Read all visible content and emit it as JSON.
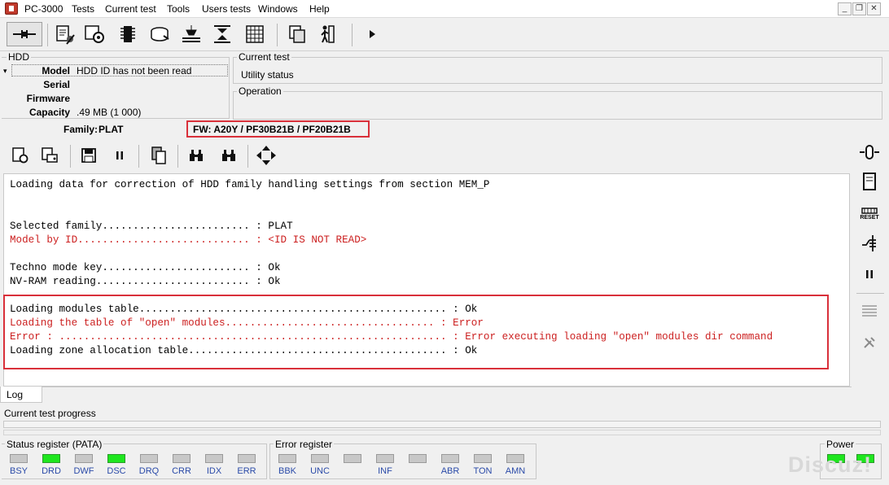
{
  "menubar": {
    "app_title": "PC-3000",
    "items": [
      "Tests",
      "Current test",
      "Tools",
      "Users tests",
      "Windows",
      "Help"
    ],
    "window_buttons": [
      "_",
      "❐",
      "✕"
    ]
  },
  "toolbar": {
    "icons": [
      "connect-icon",
      "test-tools-icon",
      "settings-gear-icon",
      "chip-icon",
      "hdd-icon",
      "head-icon",
      "head-map-icon",
      "grid-icon",
      "copy-windows-icon",
      "run-man-icon",
      "play-icon"
    ]
  },
  "hdd": {
    "title": "HDD",
    "model_label": "Model",
    "model_value": "HDD ID has not been read",
    "serial_label": "Serial",
    "serial_value": "",
    "firmware_label": "Firmware",
    "firmware_value": "",
    "capacity_label": "Capacity",
    "capacity_value": ".49 MB (1 000)",
    "family_label": "Family:",
    "family_value": "PLAT"
  },
  "current_test": {
    "title": "Current test",
    "value": "Utility status"
  },
  "operation": {
    "title": "Operation"
  },
  "fw": {
    "text": "FW: A20Y / PF30B21B / PF20B21B"
  },
  "log": {
    "lines": [
      {
        "text": "Loading data for correction of HDD family handling settings from section MEM_P",
        "color": "#000000"
      },
      {
        "text": "Selected family........................ : PLAT",
        "color": "#000000"
      },
      {
        "text": "Model by ID............................ : <ID IS NOT READ>",
        "color": "#cc2020"
      },
      {
        "text": "Techno mode key........................ : Ok",
        "color": "#000000"
      },
      {
        "text": "NV-RAM reading......................... : Ok",
        "color": "#000000"
      },
      {
        "text": "Loading modules table.................................................. : Ok",
        "color": "#000000"
      },
      {
        "text": "Loading the table of \"open\" modules.................................. : Error",
        "color": "#cc2020"
      },
      {
        "text": "Error : ............................................................... : Error executing loading \"open\" modules dir command",
        "color": "#cc2020"
      },
      {
        "text": "Loading zone allocation table.......................................... : Ok",
        "color": "#000000"
      }
    ],
    "tab_label": "Log"
  },
  "right_panel": {
    "icons": [
      "power-switch-icon",
      "drive-icon",
      "reset-icon",
      "tool-arm-icon",
      "pause-icon",
      "list-icon",
      "wrench-icon"
    ],
    "reset_label": "RESET"
  },
  "progress": {
    "label": "Current test progress",
    "value": 0
  },
  "status_register": {
    "title": "Status register (PATA)",
    "bits": [
      {
        "label": "BSY",
        "on": false
      },
      {
        "label": "DRD",
        "on": true
      },
      {
        "label": "DWF",
        "on": false
      },
      {
        "label": "DSC",
        "on": true
      },
      {
        "label": "DRQ",
        "on": false
      },
      {
        "label": "CRR",
        "on": false
      },
      {
        "label": "IDX",
        "on": false
      },
      {
        "label": "ERR",
        "on": false
      }
    ]
  },
  "error_register": {
    "title": "Error register",
    "bits": [
      {
        "label": "BBK",
        "on": false
      },
      {
        "label": "UNC",
        "on": false
      },
      {
        "label": "",
        "on": false
      },
      {
        "label": "INF",
        "on": false
      },
      {
        "label": "",
        "on": false
      },
      {
        "label": "ABR",
        "on": false
      },
      {
        "label": "TON",
        "on": false
      },
      {
        "label": "AMN",
        "on": false
      }
    ]
  },
  "power": {
    "title": "Power",
    "leds": [
      true,
      true
    ]
  },
  "watermark": "Discuz!",
  "colors": {
    "highlight_red": "#d9303a",
    "log_red": "#cc2020",
    "led_on": "#1ee61e",
    "led_off": "#c8c8c8"
  }
}
